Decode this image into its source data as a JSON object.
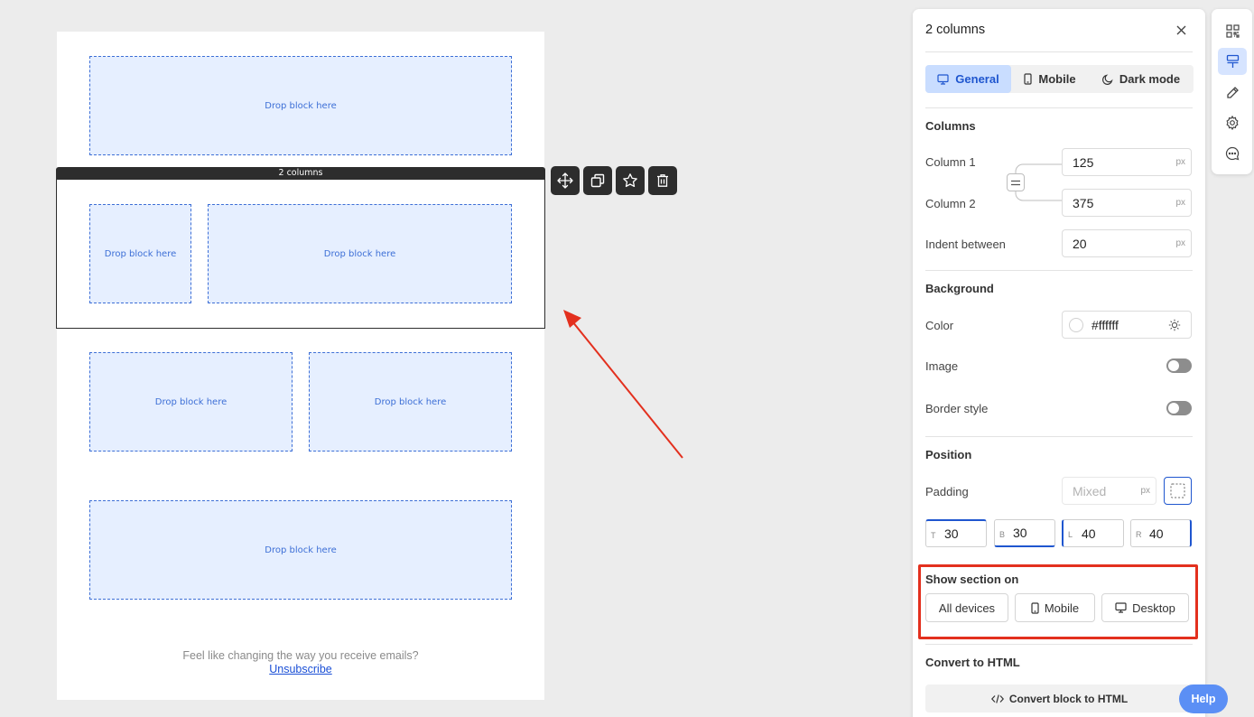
{
  "canvas": {
    "drop_label": "Drop block here",
    "selected_block_label": "2 columns",
    "footer_text": "Feel like changing the way you receive emails?",
    "unsubscribe_label": "Unsubscribe"
  },
  "panel": {
    "title": "2 columns",
    "tabs": [
      {
        "label": "General",
        "icon": "desktop-icon",
        "active": true
      },
      {
        "label": "Mobile",
        "icon": "phone-icon",
        "active": false
      },
      {
        "label": "Dark mode",
        "icon": "moon-icon",
        "active": false
      }
    ],
    "columns": {
      "heading": "Columns",
      "column1_label": "Column 1",
      "column1_value": "125",
      "column2_label": "Column 2",
      "column2_value": "375",
      "indent_label": "Indent between",
      "indent_value": "20",
      "unit": "px"
    },
    "background": {
      "heading": "Background",
      "color_label": "Color",
      "color_value": "#ffffff",
      "image_label": "Image",
      "image_enabled": false,
      "border_label": "Border style",
      "border_enabled": false
    },
    "position": {
      "heading": "Position",
      "padding_label": "Padding",
      "padding_placeholder": "Mixed",
      "unit": "px",
      "sides": [
        {
          "tag": "T",
          "value": "30"
        },
        {
          "tag": "B",
          "value": "30"
        },
        {
          "tag": "L",
          "value": "40"
        },
        {
          "tag": "R",
          "value": "40"
        }
      ]
    },
    "show_section": {
      "heading": "Show section on",
      "all_label": "All devices",
      "mobile_label": "Mobile",
      "desktop_label": "Desktop"
    },
    "convert": {
      "heading": "Convert to HTML",
      "button_label": "Convert block to HTML"
    }
  },
  "help_label": "Help",
  "colors": {
    "accent": "#1f56cf",
    "highlight_box": "#e3301e",
    "arrow": "#e3301e",
    "drop_fill": "#e6efff"
  }
}
